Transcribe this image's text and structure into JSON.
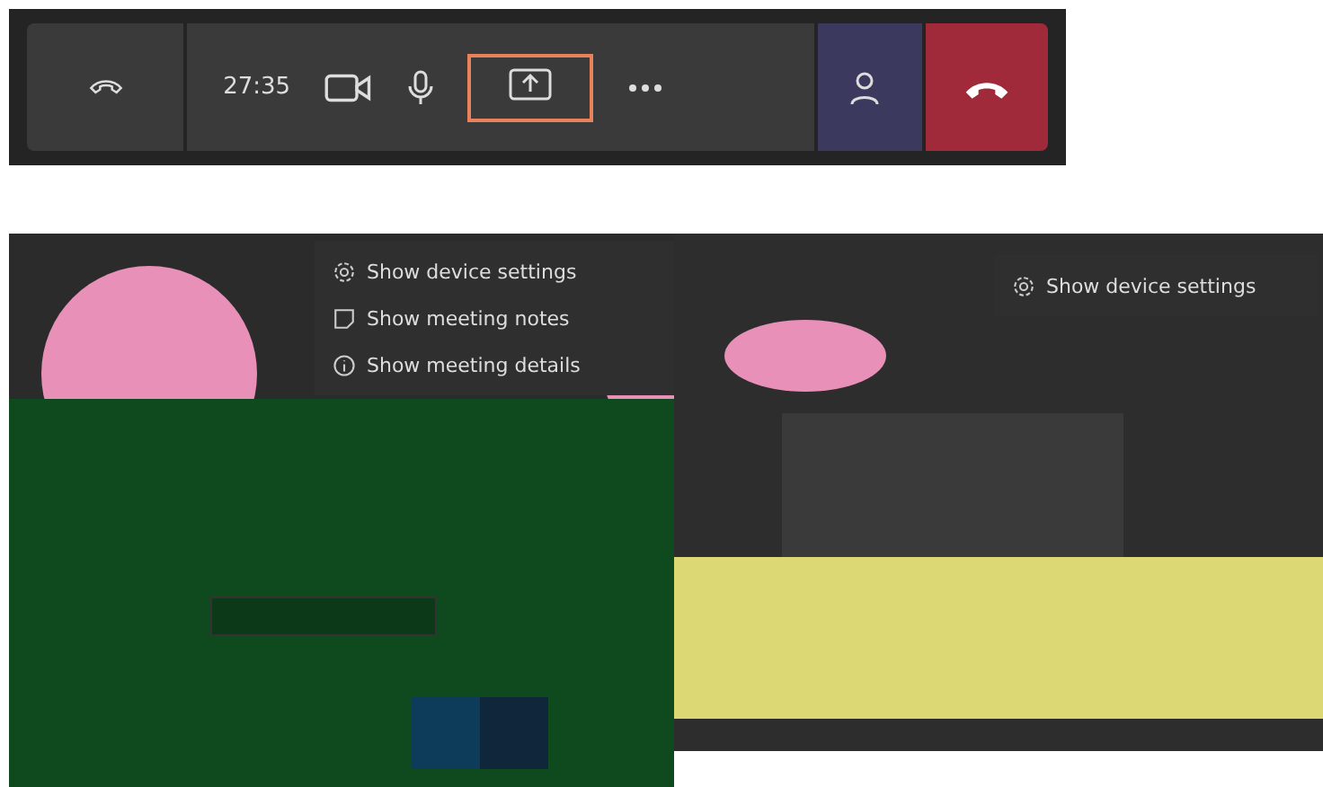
{
  "toolbar": {
    "timer": "27:35"
  },
  "left_view": {
    "menu": [
      {
        "label": "Show device settings",
        "kind": "settings"
      },
      {
        "label": "Show meeting notes",
        "kind": "notes"
      },
      {
        "label": "Show meeting details",
        "kind": "details"
      }
    ]
  },
  "right_view": {
    "menu": [
      {
        "label": "Show device settings",
        "kind": "settings"
      }
    ]
  }
}
